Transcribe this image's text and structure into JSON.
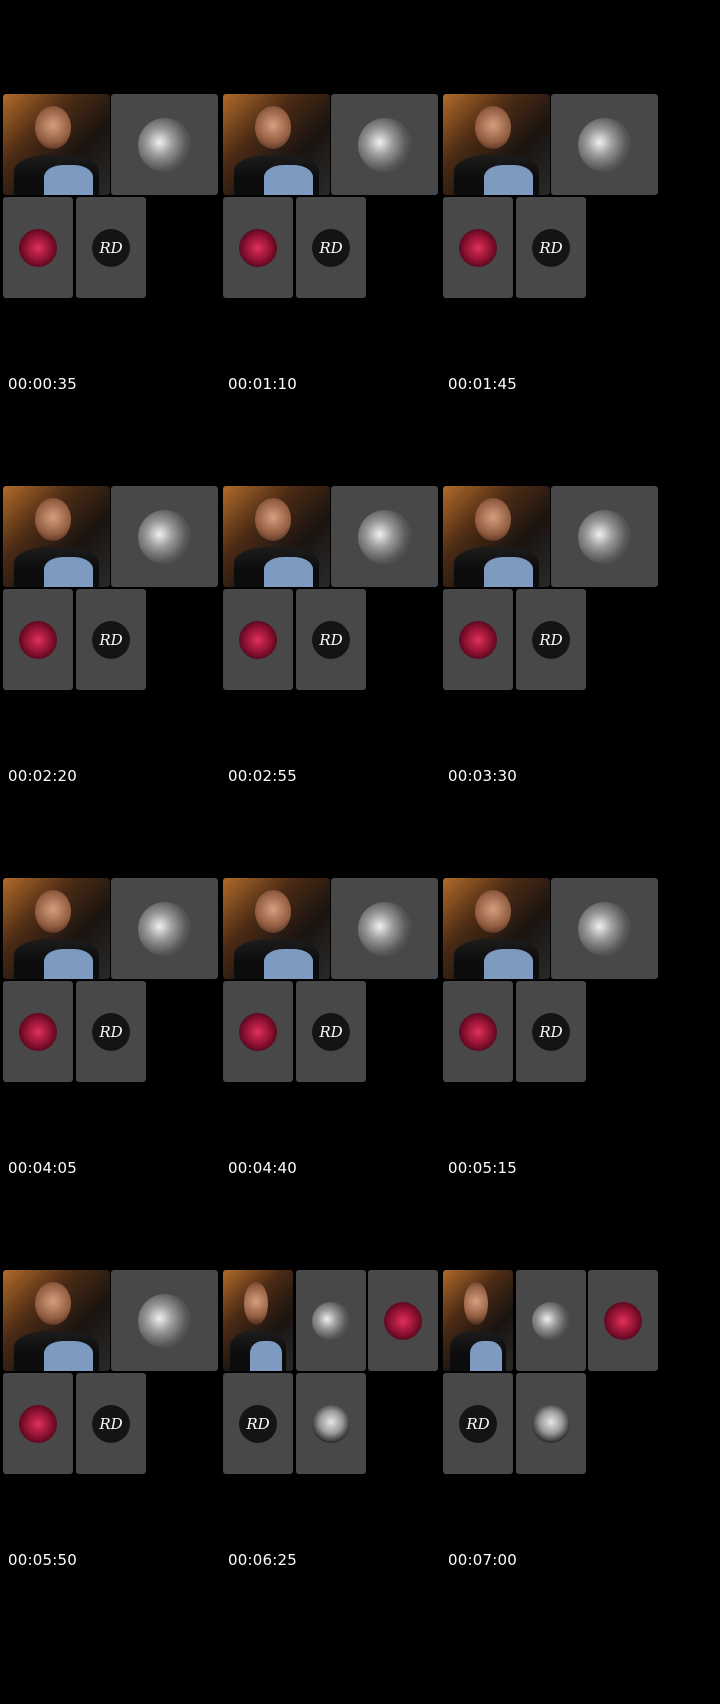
{
  "thumbnails": [
    {
      "timestamp": "00:00:35",
      "layout": "A",
      "tiles": [
        "cam-phone",
        "moon-avatar-icon",
        "red-logo-avatar-icon",
        "rd-logo-avatar-icon"
      ]
    },
    {
      "timestamp": "00:01:10",
      "layout": "A",
      "tiles": [
        "cam",
        "moon-avatar-icon",
        "red-logo-avatar-icon",
        "rd-logo-avatar-icon"
      ]
    },
    {
      "timestamp": "00:01:45",
      "layout": "A",
      "tiles": [
        "cam",
        "moon-avatar-icon",
        "red-logo-avatar-icon",
        "rd-logo-avatar-icon"
      ]
    },
    {
      "timestamp": "00:02:20",
      "layout": "A",
      "tiles": [
        "cam",
        "moon-avatar-icon",
        "red-logo-avatar-icon",
        "rd-logo-avatar-icon"
      ]
    },
    {
      "timestamp": "00:02:55",
      "layout": "A",
      "tiles": [
        "cam",
        "moon-avatar-icon",
        "red-logo-avatar-icon",
        "rd-logo-avatar-icon"
      ]
    },
    {
      "timestamp": "00:03:30",
      "layout": "A",
      "tiles": [
        "cam",
        "moon-avatar-icon",
        "red-logo-avatar-icon",
        "rd-logo-avatar-icon"
      ]
    },
    {
      "timestamp": "00:04:05",
      "layout": "A",
      "tiles": [
        "cam",
        "moon-avatar-icon",
        "red-logo-avatar-icon",
        "rd-logo-avatar-icon"
      ]
    },
    {
      "timestamp": "00:04:40",
      "layout": "A",
      "tiles": [
        "cam",
        "moon-avatar-icon",
        "red-logo-avatar-icon",
        "rd-logo-avatar-icon"
      ]
    },
    {
      "timestamp": "00:05:15",
      "layout": "A",
      "tiles": [
        "cam",
        "moon-avatar-icon",
        "red-logo-avatar-icon",
        "rd-logo-avatar-icon"
      ]
    },
    {
      "timestamp": "00:05:50",
      "layout": "A",
      "tiles": [
        "cam",
        "moon-avatar-icon",
        "red-logo-avatar-icon",
        "rd-logo-avatar-icon"
      ]
    },
    {
      "timestamp": "00:06:25",
      "layout": "B",
      "tiles": [
        "cam",
        "moon-avatar-icon",
        "red-logo-avatar-icon",
        "rd-logo-avatar-icon",
        "mask-avatar-icon"
      ]
    },
    {
      "timestamp": "00:07:00",
      "layout": "B",
      "tiles": [
        "cam",
        "moon-avatar-icon",
        "red-logo-avatar-icon",
        "rd-logo-avatar-icon",
        "mask-avatar-icon"
      ]
    }
  ],
  "rd_logo_text": "RD",
  "colors": {
    "background": "#000000",
    "tile": "#484848",
    "text": "#ffffff"
  }
}
